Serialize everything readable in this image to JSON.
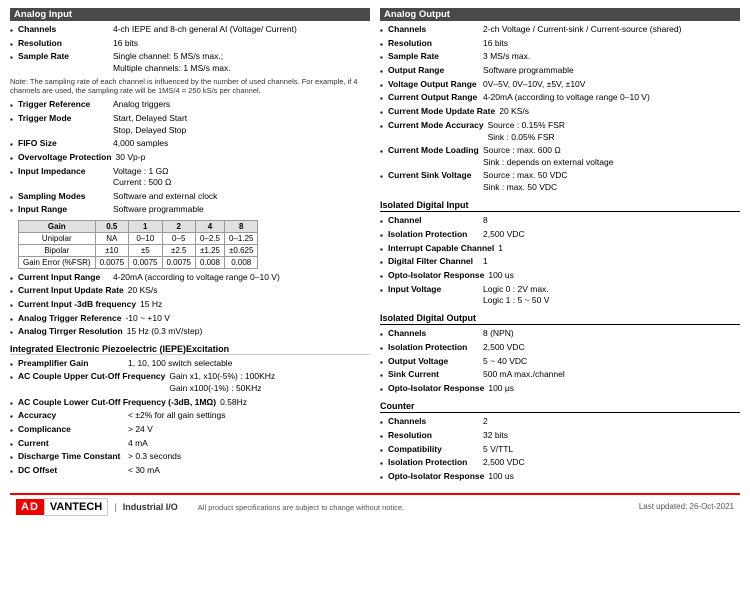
{
  "left_col": {
    "header": "Analog Input",
    "items": [
      {
        "label": "Channels",
        "value": "4-ch IEPE and 8-ch general AI (Voltage/ Current)"
      },
      {
        "label": "Resolution",
        "value": "16 bits"
      },
      {
        "label": "Sample Rate",
        "value": "Single channel: 5 MS/s max.;\nMultiple channels: 1 MS/s max."
      }
    ],
    "note": "Note: The sampling rate of each channel is influenced by the number of used channels. For example, if 4 channels are used, the sampling rate will be 1MS/4 = 250 kS/s per channel.",
    "items2": [
      {
        "label": "Trigger Reference",
        "value": "Analog triggers"
      },
      {
        "label": "Trigger Mode",
        "value": "Start, Delayed Start\nStop, Delayed Stop"
      },
      {
        "label": "FIFO Size",
        "value": "4,000 samples"
      },
      {
        "label": "Overvoltage Protection",
        "value": "30 Vp-p"
      },
      {
        "label": "Input Impedance",
        "value": "Voltage : 1 GΩ\nCurrent : 500 Ω"
      },
      {
        "label": "Sampling Modes",
        "value": "Software and external clock"
      },
      {
        "label": "Input Range",
        "value": "Software programmable"
      }
    ],
    "gain_table": {
      "headers": [
        "Gain",
        "0.5",
        "1",
        "2",
        "4",
        "8"
      ],
      "rows": [
        [
          "Unipolar",
          "NA",
          "0–10",
          "0–5",
          "0–2.5",
          "0–1.25"
        ],
        [
          "Bipolar",
          "±10",
          "±5",
          "±2.5",
          "±1.25",
          "±0.625"
        ],
        [
          "Gain Error (%FSR)",
          "0.0075",
          "0.0075",
          "0.0075",
          "0.008",
          "0.008"
        ]
      ]
    },
    "items3": [
      {
        "label": "Current Input Range",
        "value": "4-20mA (according to voltage range 0–10 V)"
      },
      {
        "label": "Current Input Update Rate",
        "value": "20 KS/s"
      },
      {
        "label": "Current Input -3dB frequency",
        "value": "15 Hz"
      },
      {
        "label": "Analog Trigger Reference",
        "value": "-10 ~ +10 V"
      },
      {
        "label": "Analog Tirrger Resolution",
        "value": "15 Hz (0.3 mV/step)"
      }
    ],
    "iepe": {
      "title": "Integrated Electronic Piezoelectric (IEPE)Excitation",
      "items": [
        {
          "label": "Preamplifier Gain",
          "value": "1, 10, 100 switch selectable"
        },
        {
          "label": "AC Couple Upper Cut-Off Frequency",
          "value": "Gain x1, x10(-5%) : 100KHz\nGain x100(-1%) : 50KHz"
        },
        {
          "label": "AC Couple Lower Cut-Off Frequency (-3dB, 1MΩ)",
          "value": "0.58Hz"
        },
        {
          "label": "Accuracy",
          "value": "< ±2% for all gain settings"
        },
        {
          "label": "Complicance",
          "value": "> 24 V"
        },
        {
          "label": "Current",
          "value": "4 mA"
        },
        {
          "label": "Discharge Time Constant",
          "value": "> 0.3 seconds"
        },
        {
          "label": "DC Offset",
          "value": "< 30 mA"
        }
      ]
    }
  },
  "right_col": {
    "header": "Analog Output",
    "items": [
      {
        "label": "Channels",
        "value": "2-ch Voltage / Current-sink / Current-source (shared)"
      },
      {
        "label": "Resolution",
        "value": "16 bits"
      },
      {
        "label": "Sample Rate",
        "value": "3 MS/s max."
      },
      {
        "label": "Output Range",
        "value": "Software programmable"
      },
      {
        "label": "Voltage Output Range",
        "value": "0V–5V, 0V–10V, ±5V, ±10V"
      },
      {
        "label": "Current Output Range",
        "value": "4-20mA (according to voltage range 0–10 V)"
      },
      {
        "label": "Current Mode Update Rate",
        "value": "20 KS/s"
      },
      {
        "label": "Current Mode Accuracy",
        "value": "Source : 0.15% FSR\nSink : 0.05% FSR"
      },
      {
        "label": "Current Mode Loading",
        "value": "Source : max. 600 Ω\nSink : depends on external voltage"
      },
      {
        "label": "Current Sink Voltage",
        "value": "Source : max. 50 VDC\nSink : max. 50 VDC"
      }
    ],
    "isolated_digital_input": {
      "title": "Isolated Digital Input",
      "items": [
        {
          "label": "Channel",
          "value": "8"
        },
        {
          "label": "Isolation Protection",
          "value": "2,500 VDC"
        },
        {
          "label": "Interrupt Capable Channel",
          "value": "1"
        },
        {
          "label": "Digital Filter Channel",
          "value": "1"
        },
        {
          "label": "Opto-Isolator Response",
          "value": "100 us"
        },
        {
          "label": "Input Voltage",
          "value": "Logic 0 : 2V max.\nLogic 1 : 5 ~ 50 V"
        }
      ]
    },
    "isolated_digital_output": {
      "title": "Isolated Digital Output",
      "items": [
        {
          "label": "Channels",
          "value": "8 (NPN)"
        },
        {
          "label": "Isolation Protection",
          "value": "2,500 VDC"
        },
        {
          "label": "Output Voltage",
          "value": "5 ~ 40 VDC"
        },
        {
          "label": "Sink Current",
          "value": "500 mA max./channel"
        },
        {
          "label": "Opto-Isolator Response",
          "value": "100 μs"
        }
      ]
    },
    "counter": {
      "title": "Counter",
      "items": [
        {
          "label": "Channels",
          "value": "2"
        },
        {
          "label": "Resolution",
          "value": "32 bits"
        },
        {
          "label": "Compatibility",
          "value": "5 V/TTL"
        },
        {
          "label": "Isolation Protection",
          "value": "2,500 VDC"
        },
        {
          "label": "Opto-Isolator Response",
          "value": "100 us"
        }
      ]
    }
  },
  "footer": {
    "logo_adv": "AD",
    "logo_vantech": "VANTECH",
    "logo_pipe": "|",
    "center": "Industrial I/O",
    "note": "All product specifications are subject to change without notice.",
    "right": "Last updated: 26-Oct-2021"
  }
}
